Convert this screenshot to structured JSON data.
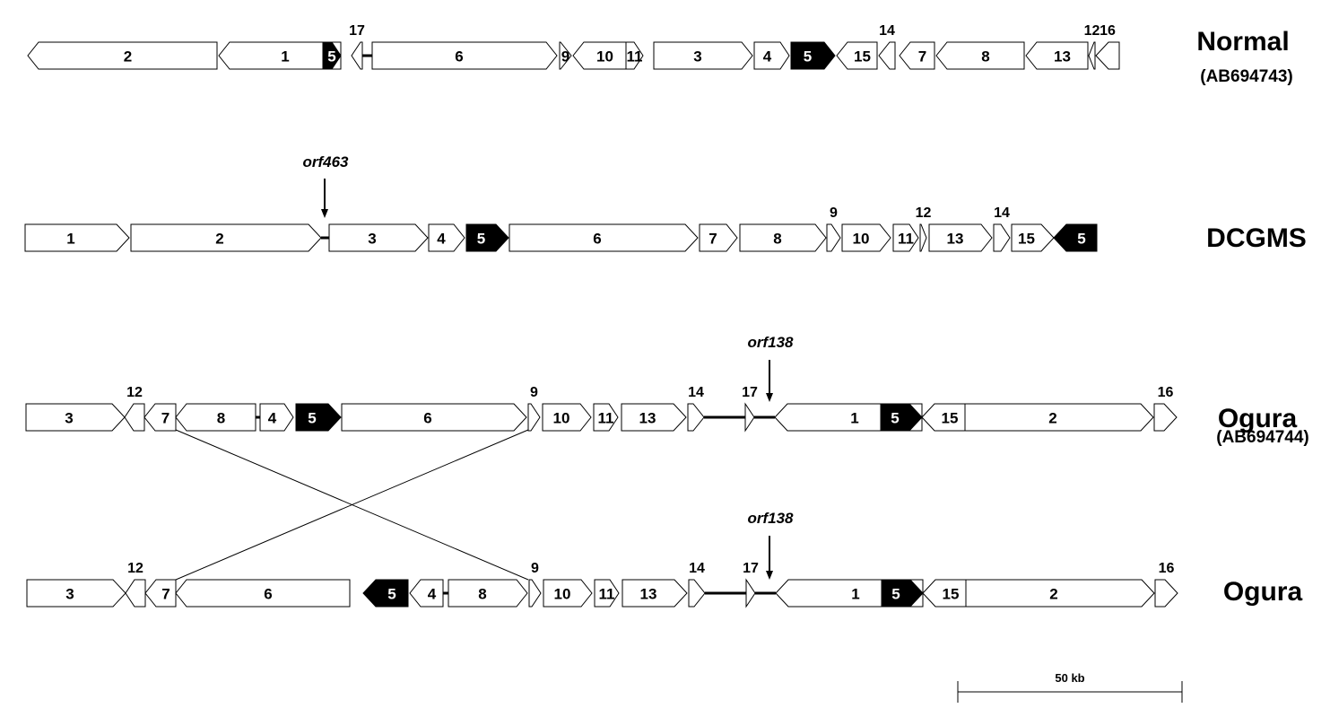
{
  "figure": {
    "tracks": [
      {
        "name": "Normal",
        "accession": "(AB694743)",
        "genes": [
          {
            "label": "2",
            "dir": "left"
          },
          {
            "label": "1",
            "dir": "left"
          },
          {
            "label": "5",
            "dir": "right",
            "highlight": true
          },
          {
            "label": "17",
            "dir": "left",
            "label_above": true
          },
          {
            "label": "6",
            "dir": "right"
          },
          {
            "label": "9",
            "dir": "right"
          },
          {
            "label": "10",
            "dir": "left"
          },
          {
            "label": "11",
            "dir": "right"
          },
          {
            "label": "3",
            "dir": "right"
          },
          {
            "label": "4",
            "dir": "right"
          },
          {
            "label": "5",
            "dir": "right",
            "highlight": true
          },
          {
            "label": "15",
            "dir": "left"
          },
          {
            "label": "14",
            "dir": "left",
            "label_above": true
          },
          {
            "label": "7",
            "dir": "left"
          },
          {
            "label": "8",
            "dir": "left"
          },
          {
            "label": "13",
            "dir": "left"
          },
          {
            "label": "12",
            "dir": "left",
            "label_above": true
          },
          {
            "label": "16",
            "dir": "left",
            "label_above": true
          }
        ]
      },
      {
        "name": "DCGMS",
        "accession": "",
        "annotation": "orf463",
        "genes": [
          {
            "label": "1",
            "dir": "right"
          },
          {
            "label": "2",
            "dir": "right"
          },
          {
            "label": "3",
            "dir": "right"
          },
          {
            "label": "4",
            "dir": "right"
          },
          {
            "label": "5",
            "dir": "right",
            "highlight": true
          },
          {
            "label": "6",
            "dir": "right"
          },
          {
            "label": "7",
            "dir": "right"
          },
          {
            "label": "8",
            "dir": "right"
          },
          {
            "label": "9",
            "dir": "right",
            "label_above": true
          },
          {
            "label": "10",
            "dir": "right"
          },
          {
            "label": "11",
            "dir": "right"
          },
          {
            "label": "12",
            "dir": "right",
            "label_above": true
          },
          {
            "label": "13",
            "dir": "right"
          },
          {
            "label": "14",
            "dir": "right",
            "label_above": true
          },
          {
            "label": "15",
            "dir": "right"
          },
          {
            "label": "5",
            "dir": "left",
            "highlight": true
          }
        ]
      },
      {
        "name": "Ogura",
        "accession": "(AB694744)",
        "annotation": "orf138",
        "genes": [
          {
            "label": "3",
            "dir": "right"
          },
          {
            "label": "12",
            "dir": "left",
            "label_above": true
          },
          {
            "label": "7",
            "dir": "left"
          },
          {
            "label": "8",
            "dir": "left"
          },
          {
            "label": "4",
            "dir": "right"
          },
          {
            "label": "5",
            "dir": "right",
            "highlight": true
          },
          {
            "label": "6",
            "dir": "right"
          },
          {
            "label": "9",
            "dir": "right",
            "label_above": true
          },
          {
            "label": "10",
            "dir": "right"
          },
          {
            "label": "11",
            "dir": "right"
          },
          {
            "label": "13",
            "dir": "right"
          },
          {
            "label": "14",
            "dir": "right",
            "label_above": true
          },
          {
            "label": "17",
            "dir": "right",
            "label_above": true
          },
          {
            "label": "1",
            "dir": "left"
          },
          {
            "label": "5",
            "dir": "right",
            "highlight": true
          },
          {
            "label": "15",
            "dir": "left"
          },
          {
            "label": "2",
            "dir": "right"
          },
          {
            "label": "16",
            "dir": "right",
            "label_above": true
          }
        ]
      },
      {
        "name": "Ogura",
        "accession": "",
        "annotation": "orf138",
        "genes": [
          {
            "label": "3",
            "dir": "right"
          },
          {
            "label": "12",
            "dir": "left",
            "label_above": true
          },
          {
            "label": "7",
            "dir": "left"
          },
          {
            "label": "6",
            "dir": "left"
          },
          {
            "label": "5",
            "dir": "left",
            "highlight": true
          },
          {
            "label": "4",
            "dir": "left"
          },
          {
            "label": "8",
            "dir": "right"
          },
          {
            "label": "9",
            "dir": "right",
            "label_above": true
          },
          {
            "label": "10",
            "dir": "right"
          },
          {
            "label": "11",
            "dir": "right"
          },
          {
            "label": "13",
            "dir": "right"
          },
          {
            "label": "14",
            "dir": "right",
            "label_above": true
          },
          {
            "label": "17",
            "dir": "right",
            "label_above": true
          },
          {
            "label": "1",
            "dir": "left"
          },
          {
            "label": "5",
            "dir": "right",
            "highlight": true
          },
          {
            "label": "15",
            "dir": "left"
          },
          {
            "label": "2",
            "dir": "right"
          },
          {
            "label": "16",
            "dir": "right",
            "label_above": true
          }
        ]
      }
    ],
    "scale_bar": {
      "label": "50 kb",
      "length_kb": 50
    },
    "colors": {
      "gene_fill": "#ffffff",
      "highlight_fill": "#000000",
      "stroke": "#000000"
    }
  }
}
